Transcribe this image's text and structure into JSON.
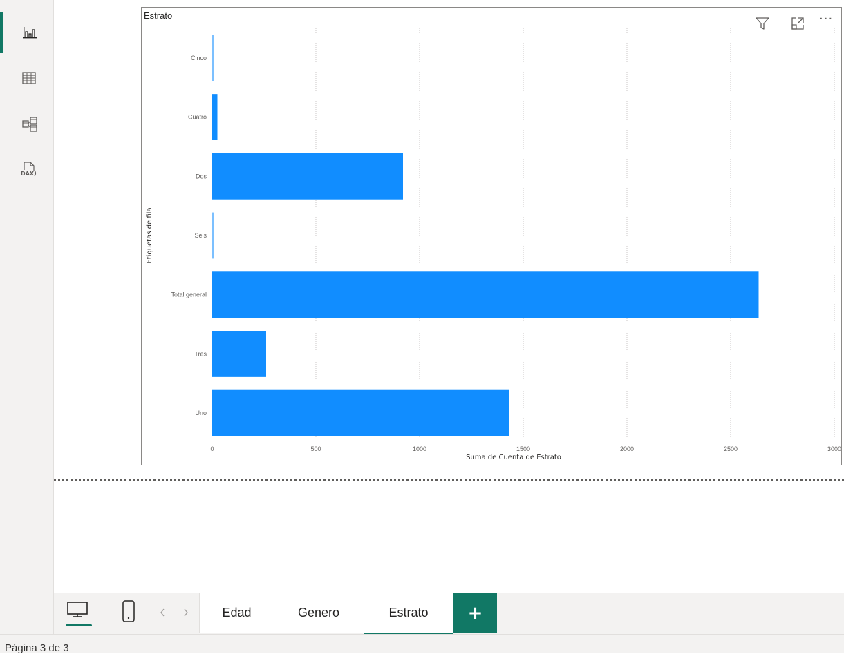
{
  "rail": {
    "items": [
      {
        "name": "report-view",
        "icon": "bar-chart-icon",
        "active": true
      },
      {
        "name": "data-view",
        "icon": "table-icon",
        "active": false
      },
      {
        "name": "model-view",
        "icon": "model-icon",
        "active": false
      },
      {
        "name": "dax-query-view",
        "icon": "dax-icon",
        "active": false
      }
    ],
    "dax_label": "DAX"
  },
  "visual": {
    "title": "Estrato",
    "header_icons": [
      "filter-icon",
      "focus-mode-icon",
      "more-options-icon"
    ],
    "more_label": "···"
  },
  "chart_data": {
    "type": "bar",
    "orientation": "horizontal",
    "categories": [
      "Cinco",
      "Cuatro",
      "Dos",
      "Seis",
      "Total general",
      "Tres",
      "Uno"
    ],
    "values": [
      4,
      25,
      920,
      5,
      2635,
      260,
      1430
    ],
    "xlabel": "Suma de Cuenta de Estrato",
    "ylabel": "Etiquetas de fila",
    "xlim": [
      0,
      3000
    ],
    "x_ticks": [
      0,
      500,
      1000,
      1500,
      2000,
      2500,
      3000
    ],
    "x_tick_labels": [
      "0",
      "500",
      "1000",
      "1500",
      "2000",
      "2500",
      "3000"
    ],
    "bar_color": "#118DFF",
    "grid": "vertical-dotted"
  },
  "tabs": {
    "desktop_icon": "desktop-icon",
    "mobile_icon": "mobile-icon",
    "prev_icon": "chevron-left-icon",
    "next_icon": "chevron-right-icon",
    "pages": [
      {
        "label": "Edad",
        "active": false
      },
      {
        "label": "Genero",
        "active": false
      },
      {
        "label": "Estrato",
        "active": true
      }
    ],
    "add_label": "+"
  },
  "status": {
    "page_label": "Página 3 de 3"
  },
  "colors": {
    "accent": "#117865",
    "bar": "#118DFF"
  }
}
